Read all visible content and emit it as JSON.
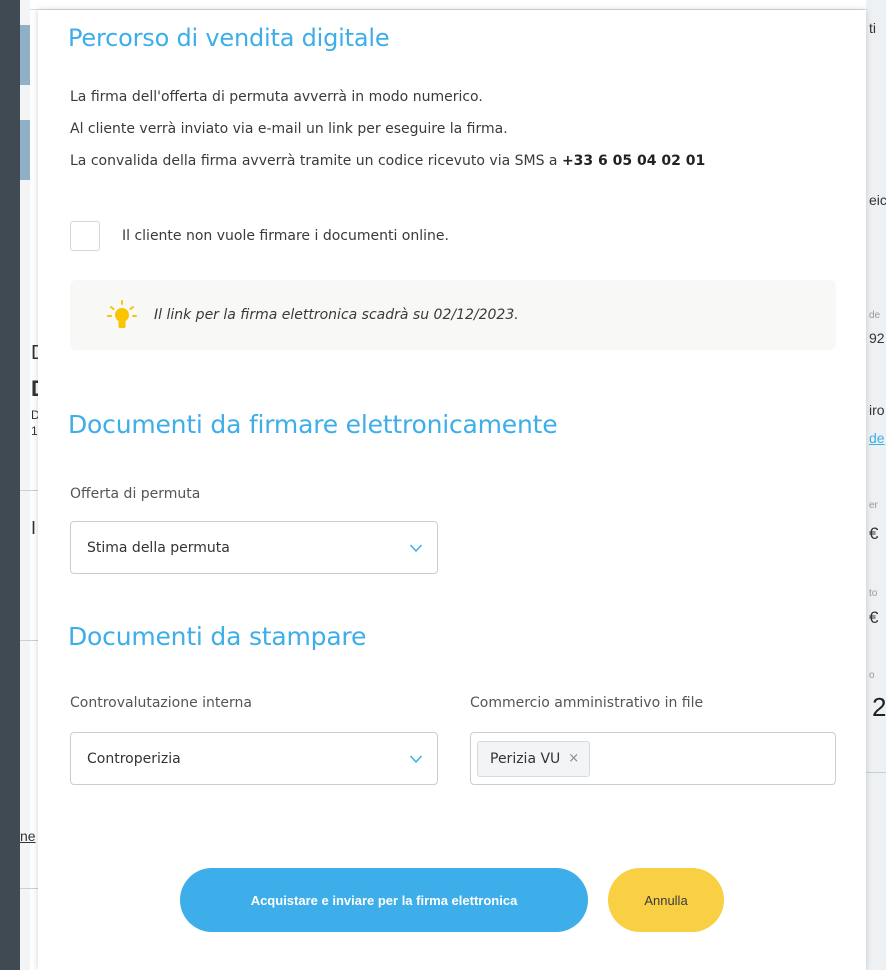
{
  "background": {
    "fragments": [
      "ti",
      "eic",
      "de",
      "92",
      "iro",
      "de",
      "er",
      "€",
      "to",
      "€",
      "o",
      "2",
      "D",
      "D",
      "D",
      "1",
      "I",
      "ne"
    ]
  },
  "modal": {
    "section_digital": {
      "title": "Percorso di vendita digitale",
      "line1": "La firma dell'offerta di permuta avverrà in modo numerico.",
      "line2": "Al cliente verrà inviato via e-mail un link per eseguire la firma.",
      "line3_prefix": "La convalida della firma avverrà tramite un codice ricevuto via SMS a ",
      "phone": "+33 6 05 04 02 01",
      "checkbox_label": "Il cliente non vuole firmare i documenti online.",
      "notice": "Il link per la firma elettronica scadrà su 02/12/2023."
    },
    "section_esign": {
      "title": "Documenti da firmare elettronicamente",
      "field_label": "Offerta di permuta",
      "select_value": "Stima della permuta"
    },
    "section_print": {
      "title": "Documenti da stampare",
      "left_label": "Controvalutazione interna",
      "left_select_value": "Controperizia",
      "right_label": "Commercio amministrativo in file",
      "chip": "Perizia VU",
      "chip_remove": "×"
    },
    "buttons": {
      "primary": "Acquistare e inviare per la firma elettronica",
      "secondary": "Annulla"
    }
  },
  "colors": {
    "accent_blue": "#3daee9",
    "accent_yellow": "#f9d044",
    "notice_bg": "#f8f8f6"
  },
  "icons": [
    "lightbulb-icon",
    "chevron-down-icon",
    "close-icon"
  ]
}
